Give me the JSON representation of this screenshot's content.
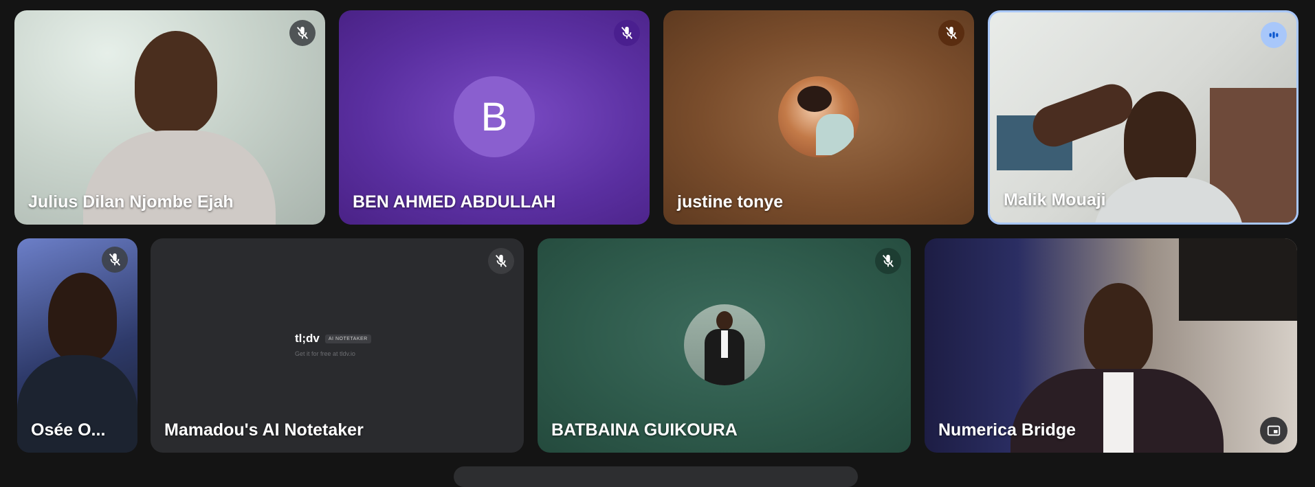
{
  "participants": [
    {
      "name": "Julius Dilan Njombe Ejah",
      "muted": true,
      "type": "video"
    },
    {
      "name": "BEN AHMED ABDULLAH",
      "muted": true,
      "type": "initial",
      "initial": "B",
      "color": "#6b3fb0"
    },
    {
      "name": "justine tonye",
      "muted": true,
      "type": "photo",
      "color": "#8a5a36"
    },
    {
      "name": "Malik Mouaji",
      "muted": false,
      "speaking": true,
      "type": "video"
    },
    {
      "name": "Osée O...",
      "muted": true,
      "type": "video"
    },
    {
      "name": "Mamadou's AI Notetaker",
      "muted": true,
      "type": "notetaker",
      "brand": "tl;dv",
      "badge": "AI NOTETAKER",
      "sub": "Get it for free at tldv.io"
    },
    {
      "name": "BATBAINA GUIKOURA",
      "muted": true,
      "type": "photo",
      "color": "#2f5a4c"
    },
    {
      "name": "Numerica Bridge",
      "muted": false,
      "type": "video"
    }
  ],
  "icons": {
    "mic_off": "mic-off-icon",
    "speaking": "audio-level-icon",
    "pip": "picture-in-picture-icon"
  },
  "colors": {
    "background": "#141414",
    "active_border": "#a8c7fa"
  }
}
